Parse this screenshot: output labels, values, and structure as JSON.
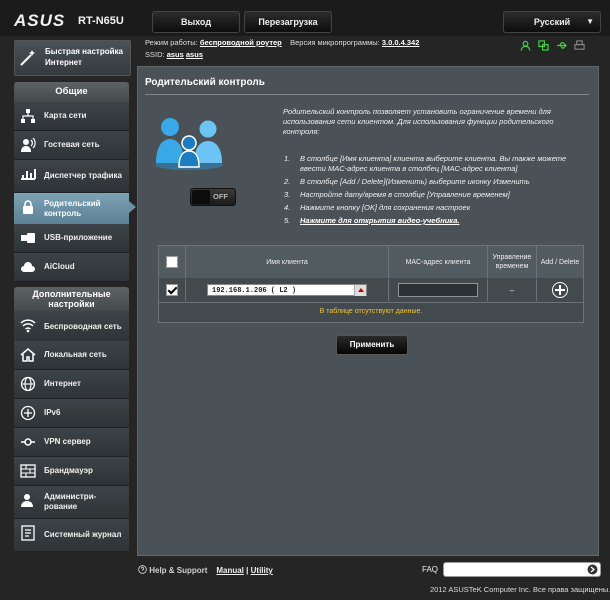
{
  "header": {
    "logo": "ASUS",
    "model": "RT-N65U",
    "logout_label": "Выход",
    "reboot_label": "Перезагрузка",
    "language": "Русский"
  },
  "status": {
    "mode_label": "Режим работы:",
    "mode_value": "беспроводной роутер",
    "firmware_label": "Версия микропрограммы:",
    "firmware_value": "3.0.0.4.342",
    "ssid_label": "SSID:",
    "ssid_1": "asus",
    "ssid_2": "asus"
  },
  "sidebar": {
    "quick_setup": "Быстрая настройка Интернет",
    "general_header": "Общие",
    "general_items": [
      {
        "label": "Карта сети",
        "icon": "network-map-icon"
      },
      {
        "label": "Гостевая сеть",
        "icon": "guest-network-icon"
      },
      {
        "label": "Диспетчер трафика",
        "icon": "traffic-manager-icon"
      },
      {
        "label": "Родительский контроль",
        "icon": "parental-control-icon",
        "active": true
      },
      {
        "label": "USB-приложение",
        "icon": "usb-icon"
      },
      {
        "label": "AiCloud",
        "icon": "cloud-icon"
      }
    ],
    "advanced_header": "Дополнительные настройки",
    "advanced_items": [
      {
        "label": "Беспроводная сеть",
        "icon": "wireless-icon"
      },
      {
        "label": "Локальная сеть",
        "icon": "home-icon"
      },
      {
        "label": "Интернет",
        "icon": "globe-icon"
      },
      {
        "label": "IPv6",
        "icon": "ipv6-icon"
      },
      {
        "label": "VPN сервер",
        "icon": "vpn-icon"
      },
      {
        "label": "Брандмауэр",
        "icon": "firewall-icon"
      },
      {
        "label": "Администри-рование",
        "icon": "admin-icon"
      },
      {
        "label": "Системный журнал",
        "icon": "log-icon"
      }
    ]
  },
  "main": {
    "title": "Родительский контроль",
    "toggle_label": "OFF",
    "intro": "Родительский контроль позволяет установить ограничение времени для использования сети клиентом. Для использования функции родительского контроля:",
    "steps": [
      "В столбце [Имя клиента] клиента выберите клиента. Вы также можете ввести MAC-адрес клиента в столбец [MAC-адрес клиента]",
      "В столбце [Add / Delete](Изменить) выберите иконку Изменить",
      "Настройте дату/время в столбце [Управление временем]",
      "Нажмите кнопку [OK] для сохранения настроек",
      "Нажмите для открытия видео-учебника."
    ],
    "table": {
      "col_client": "Имя клиента",
      "col_mac": "MAC-адрес клиента",
      "col_time": "Управление временем",
      "col_action": "Add / Delete",
      "client_value": "192.168.1.206 ( L2 )",
      "time_value": "–",
      "empty": "В таблице отсутствуют данные."
    },
    "apply_label": "Применить"
  },
  "footer": {
    "help": "Help & Support",
    "manual": "Manual",
    "separator": "|",
    "utility": "Utility",
    "faq": "FAQ",
    "copyright": "2012 ASUSTeK Computer Inc. Все права защищены."
  }
}
